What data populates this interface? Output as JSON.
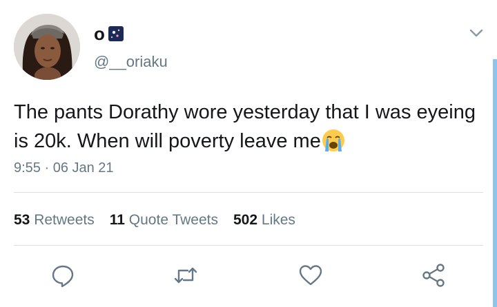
{
  "tweet": {
    "display_name": "o",
    "name_emoji": "night-sky-emoji",
    "handle": "@__oriaku",
    "text": "The pants Dorathy wore yesterday that I was eyeing is 20k. When will poverty leave me",
    "text_emoji": "loudly-crying-face-emoji",
    "timestamp": "9:55 · 06 Jan 21"
  },
  "stats": {
    "retweets_count": "53",
    "retweets_label": "Retweets",
    "quote_count": "11",
    "quote_label": "Quote Tweets",
    "likes_count": "502",
    "likes_label": "Likes"
  },
  "actions": [
    "reply-icon",
    "retweet-icon",
    "like-icon",
    "share-icon"
  ],
  "colors": {
    "text": "#14171a",
    "secondary": "#657786",
    "divider": "#d8dee3",
    "scrollbar": "#8fc3e9"
  }
}
